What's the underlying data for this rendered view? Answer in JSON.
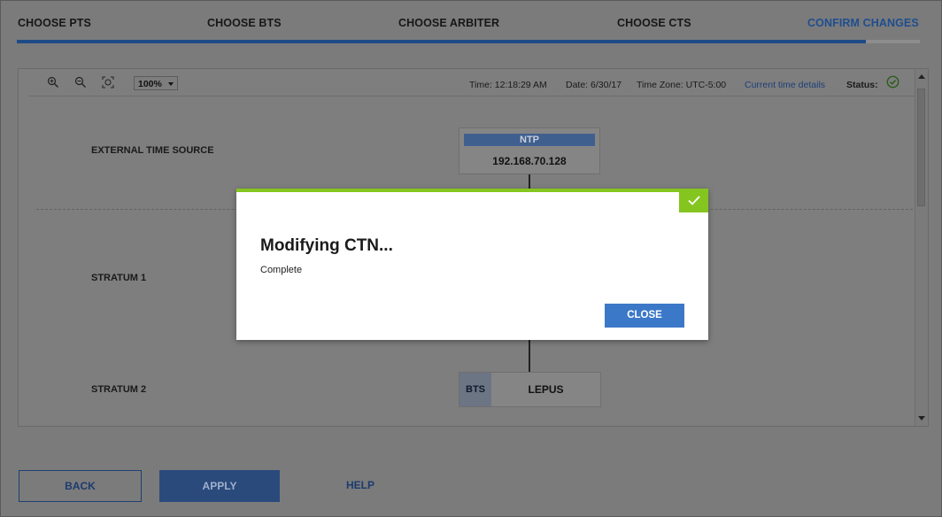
{
  "wizard": {
    "steps": [
      {
        "label": "CHOOSE PTS",
        "active": false
      },
      {
        "label": "CHOOSE BTS",
        "active": false
      },
      {
        "label": "CHOOSE ARBITER",
        "active": false
      },
      {
        "label": "CHOOSE CTS",
        "active": false
      },
      {
        "label": "CONFIRM CHANGES",
        "active": true
      }
    ],
    "progress_fraction": 0.94
  },
  "toolbar": {
    "icons": [
      "zoom-in-icon",
      "zoom-out-icon",
      "fit-to-screen-icon"
    ],
    "zoom_level": "100%",
    "time": "Time: 12:18:29 AM",
    "date": "Date: 6/30/17",
    "timezone": "Time Zone: UTC-5:00",
    "time_details_link": "Current time details",
    "status_label": "Status:",
    "status_icon": "check-circle-icon"
  },
  "diagram": {
    "rows": {
      "external": "EXTERNAL TIME SOURCE",
      "stratum1": "STRATUM 1",
      "stratum2": "STRATUM 2"
    },
    "ntp": {
      "label": "NTP",
      "ip": "192.168.70.128"
    },
    "bts": {
      "tag": "BTS",
      "name": "LEPUS"
    }
  },
  "modal": {
    "title": "Modifying CTN...",
    "message": "Complete",
    "close_label": "CLOSE",
    "check_icon": "checkmark-icon"
  },
  "buttons": {
    "back": "BACK",
    "apply": "APPLY",
    "help": "HELP"
  },
  "colors": {
    "accent_blue": "#3c78c8",
    "success_green": "#85c51f",
    "active_step": "#1f4e8f"
  }
}
